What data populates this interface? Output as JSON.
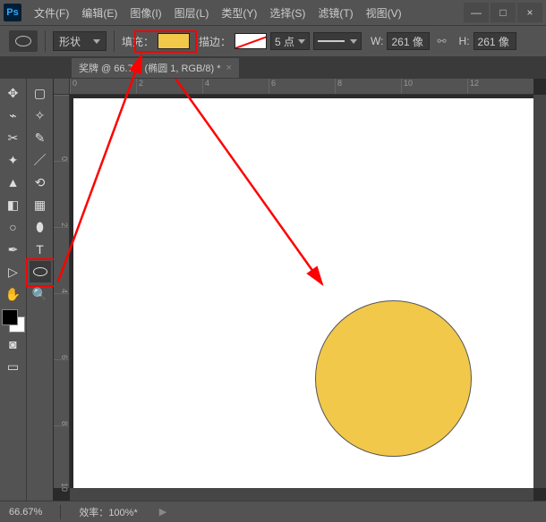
{
  "app": {
    "logo": "Ps"
  },
  "menu": {
    "file": "文件(F)",
    "edit": "编辑(E)",
    "image": "图像(I)",
    "layer": "图层(L)",
    "type": "类型(Y)",
    "select": "选择(S)",
    "filter": "滤镜(T)",
    "view": "视图(V)"
  },
  "window_controls": {
    "min": "—",
    "max": "□",
    "close": "×"
  },
  "options": {
    "shape_mode": "形状",
    "fill_label": "填充：",
    "stroke_label": "描边：",
    "stroke_size": "5 点",
    "w_label": "W:",
    "w_value": "261 像",
    "h_label": "H:",
    "h_value": "261 像",
    "link": "⚯",
    "fill_color": "#f2c84b"
  },
  "doc_tab": {
    "title": "奖牌 @ 66.7% (椭圆 1, RGB/8) *",
    "close": "×"
  },
  "ruler_h": [
    "0",
    "2",
    "4",
    "6",
    "8",
    "10",
    "12"
  ],
  "ruler_v": [
    "0",
    "2",
    "4",
    "6",
    "8",
    "10"
  ],
  "status": {
    "zoom": "66.67%",
    "efficiency_label": "效率：",
    "efficiency_value": "100%*",
    "arrow": "▶"
  },
  "colors": {
    "circle": "#f2c84b",
    "highlight": "#ff0000"
  }
}
